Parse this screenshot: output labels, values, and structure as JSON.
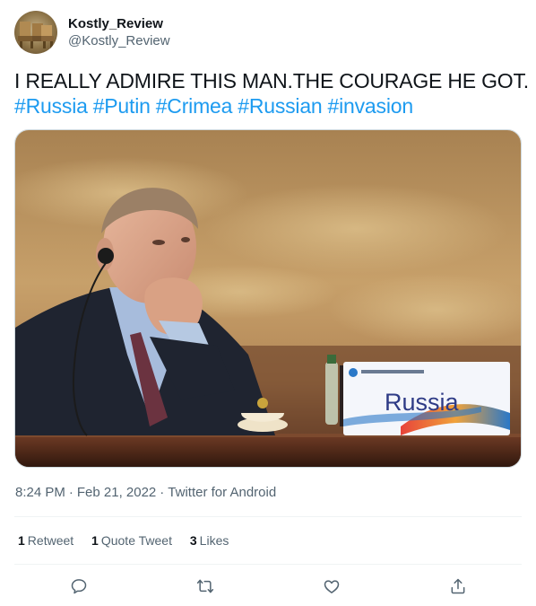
{
  "user": {
    "display_name": "Kostly_Review",
    "handle": "@Kostly_Review"
  },
  "tweet": {
    "text": "I REALLY ADMIRE THIS MAN.THE COURAGE HE GOT.",
    "hashtags": [
      "#Russia",
      "#Putin",
      "#Crimea",
      "#Russian",
      "#invasion"
    ]
  },
  "media": {
    "placard_text": "Russia"
  },
  "meta": {
    "time": "8:24 PM",
    "date": "Feb 21, 2022",
    "source": "Twitter for Android",
    "separator": "·"
  },
  "stats": {
    "retweets": {
      "count": "1",
      "label": "Retweet"
    },
    "quote_tweets": {
      "count": "1",
      "label": "Quote Tweet"
    },
    "likes": {
      "count": "3",
      "label": "Likes"
    }
  },
  "actions": [
    "reply-icon",
    "retweet-icon",
    "like-icon",
    "share-icon"
  ],
  "colors": {
    "link": "#1d9bf0",
    "secondary_text": "#536471",
    "primary_text": "#0f1419",
    "divider": "#eff3f4"
  }
}
